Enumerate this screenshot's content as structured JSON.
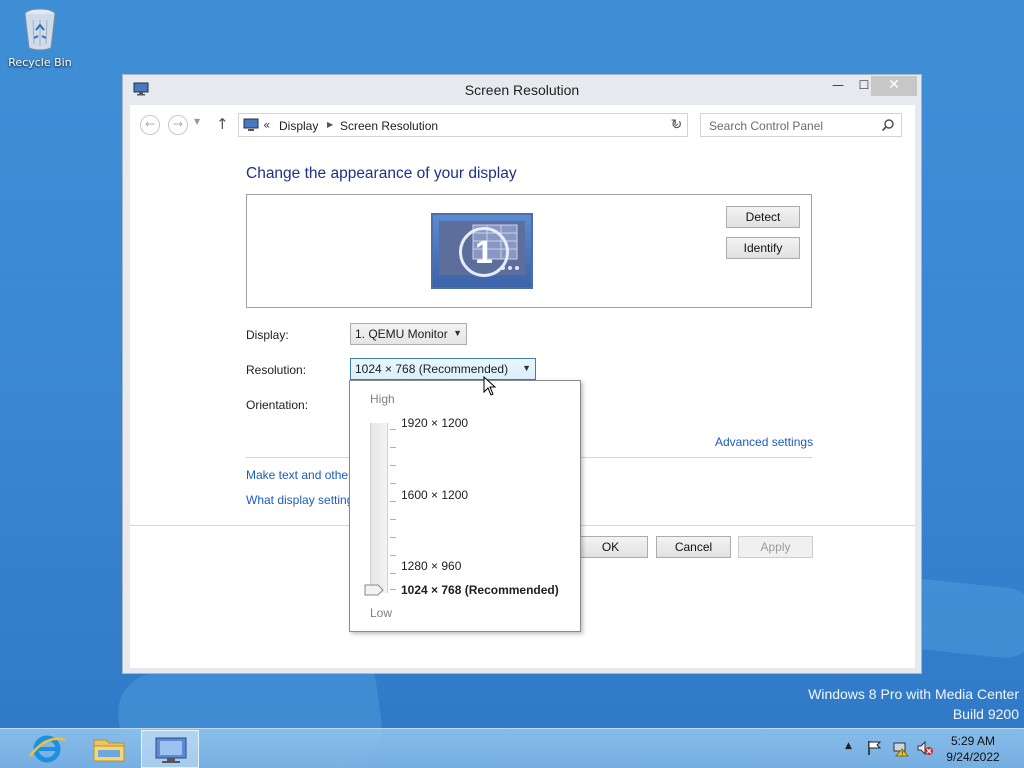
{
  "desktop": {
    "recycle_bin_label": "Recycle Bin",
    "watermark_line1": "Windows 8 Pro with Media Center",
    "watermark_line2": "Build 9200"
  },
  "window": {
    "title": "Screen Resolution",
    "minimize_glyph": "—",
    "maximize_glyph": "☐",
    "close_glyph": "✕"
  },
  "addressbar": {
    "chevron": "«",
    "crumbs": [
      "Display",
      "Screen Resolution"
    ],
    "search_placeholder": "Search Control Panel"
  },
  "content": {
    "heading": "Change the appearance of your display",
    "monitor_number": "1",
    "detect_label": "Detect",
    "identify_label": "Identify",
    "display_label": "Display:",
    "display_value": "1. QEMU Monitor",
    "resolution_label": "Resolution:",
    "resolution_value": "1024 × 768 (Recommended)",
    "orientation_label": "Orientation:",
    "advanced_link": "Advanced settings",
    "link_text_size": "Make text and other",
    "link_display_settings": "What display setting",
    "ok_label": "OK",
    "cancel_label": "Cancel",
    "apply_label": "Apply"
  },
  "resolution_flyout": {
    "high_label": "High",
    "low_label": "Low",
    "options": [
      "1920 × 1200",
      "1600 × 1200",
      "1280 × 960",
      "1024 × 768 (Recommended)"
    ],
    "selected_index": 3
  },
  "taskbar": {
    "apps": [
      "internet-explorer",
      "file-explorer",
      "control-panel"
    ],
    "time": "5:29 AM",
    "date": "9/24/2022"
  },
  "colors": {
    "desktop_bg": "#3a86d2",
    "link": "#1d5bbf",
    "heading": "#1e3287",
    "close_button": "#c7c7c7"
  }
}
